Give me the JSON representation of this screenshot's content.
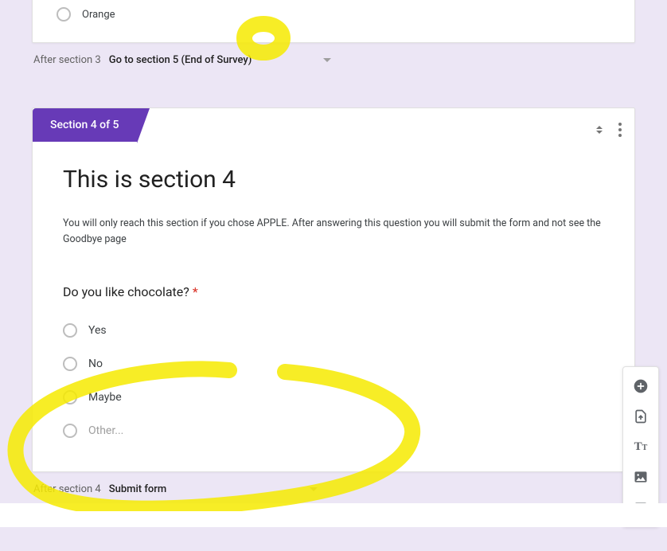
{
  "topCard": {
    "option": "Orange"
  },
  "afterSection3": {
    "label": "After section 3",
    "select": "Go to section 5 (End of Survey)"
  },
  "section4": {
    "badge": "Section 4 of 5",
    "title": "This is section 4",
    "description": "You will only reach this section if you chose APPLE. After answering this question you will submit the form and not see the Goodbye page",
    "question": "Do you like chocolate?",
    "options": [
      "Yes",
      "No",
      "Maybe"
    ],
    "otherLabel": "Other..."
  },
  "afterSection4": {
    "label": "After section 4",
    "select": "Submit form"
  },
  "toolbar": {
    "add": "Add question",
    "import": "Import questions",
    "text": "Add title and description",
    "image": "Add image",
    "video": "Add video"
  }
}
